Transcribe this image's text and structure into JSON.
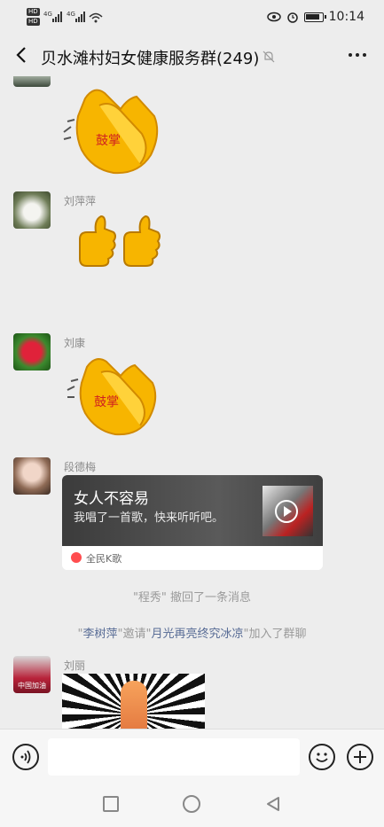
{
  "status_bar": {
    "time": "10:14",
    "network_left": "HD",
    "network_4g": "4G",
    "icons": [
      "eye-comfort-icon",
      "alarm-icon",
      "battery-icon"
    ]
  },
  "chat": {
    "title": "贝水滩村妇女健康服务群(249)",
    "muted": true
  },
  "messages": [
    {
      "sender": "",
      "type": "sticker",
      "sticker": "clapping-hands",
      "sticker_text": "鼓掌"
    },
    {
      "sender": "刘萍萍",
      "type": "sticker",
      "sticker": "two-thumbs-up"
    },
    {
      "sender": "刘康",
      "type": "sticker",
      "sticker": "clapping-hands",
      "sticker_text": "鼓掌"
    },
    {
      "sender": "段德梅",
      "type": "card",
      "card": {
        "title": "女人不容易",
        "subtitle": "我唱了一首歌，快来听听吧。",
        "app": "全民K歌"
      }
    },
    {
      "type": "system",
      "text": "\"程秀\" 撤回了一条消息"
    },
    {
      "type": "system_invite",
      "inviter": "李树萍",
      "verb": "邀请",
      "invitee": "月光再亮终究冰凉",
      "suffix": "加入了群聊"
    },
    {
      "sender": "刘丽",
      "type": "image",
      "avatar_text": "中国加油"
    }
  ],
  "input": {
    "placeholder": ""
  },
  "colors": {
    "background": "#ededed",
    "link": "#576b95",
    "system_text": "#9a9a9a"
  }
}
